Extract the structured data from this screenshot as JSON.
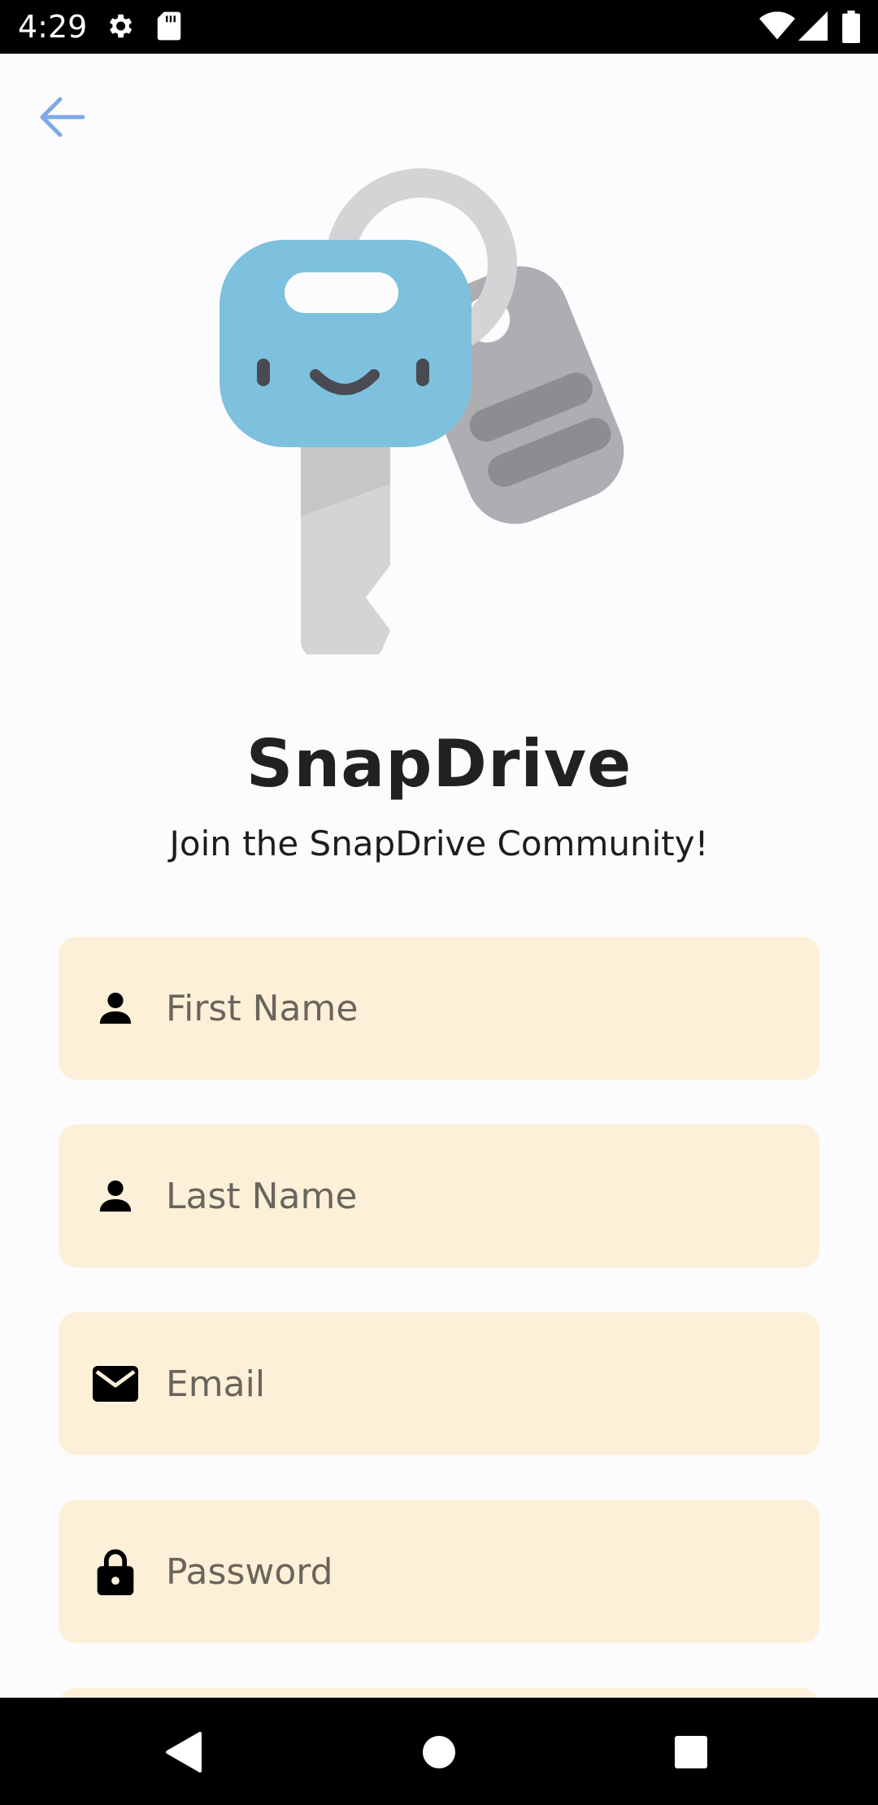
{
  "status_bar": {
    "time": "4:29",
    "icons": [
      "settings-icon",
      "sd-card-icon",
      "wifi-icon",
      "signal-icon",
      "battery-icon"
    ]
  },
  "header": {
    "back_icon": "arrow-left-icon",
    "accent_color": "#7fa9e6"
  },
  "hero": {
    "illustration": "keys-illustration",
    "title": "SnapDrive",
    "subtitle": "Join the SnapDrive Community!"
  },
  "form": {
    "fields": [
      {
        "icon": "person-icon",
        "placeholder": "First Name",
        "value": ""
      },
      {
        "icon": "person-icon",
        "placeholder": "Last Name",
        "value": ""
      },
      {
        "icon": "mail-icon",
        "placeholder": "Email",
        "value": ""
      },
      {
        "icon": "lock-icon",
        "placeholder": "Password",
        "value": ""
      }
    ],
    "field_background": "#fcf0d8"
  },
  "nav_bar": {
    "buttons": [
      "back-triangle-icon",
      "home-circle-icon",
      "recents-square-icon"
    ]
  }
}
